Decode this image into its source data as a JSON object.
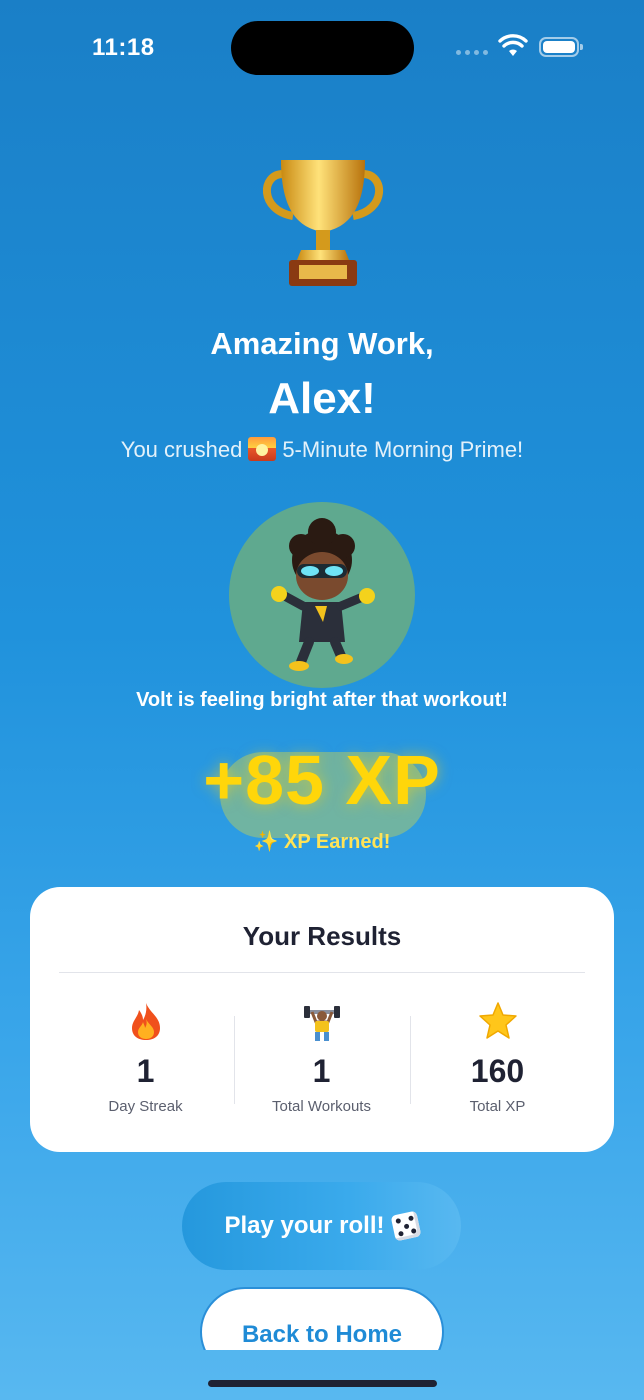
{
  "status_bar": {
    "time": "11:18"
  },
  "header": {
    "line1": "Amazing Work,",
    "line2": "Alex!",
    "subtitle_prefix": "You crushed",
    "subtitle_workout": "5-Minute Morning Prime!"
  },
  "character": {
    "caption": "Volt is feeling bright after that workout!"
  },
  "xp": {
    "value": "+85 XP",
    "label": "✨ XP Earned!"
  },
  "results": {
    "title": "Your Results",
    "stats": [
      {
        "icon": "fire-icon",
        "value": "1",
        "label": "Day Streak"
      },
      {
        "icon": "weightlifter-icon",
        "value": "1",
        "label": "Total Workouts"
      },
      {
        "icon": "star-icon",
        "value": "160",
        "label": "Total XP"
      }
    ]
  },
  "actions": {
    "play_label": "Play your roll!",
    "home_label": "Back to Home"
  },
  "colors": {
    "xp_yellow": "#ffd60a",
    "accent_blue": "#1f8bd6",
    "card_text": "#1f2233"
  }
}
